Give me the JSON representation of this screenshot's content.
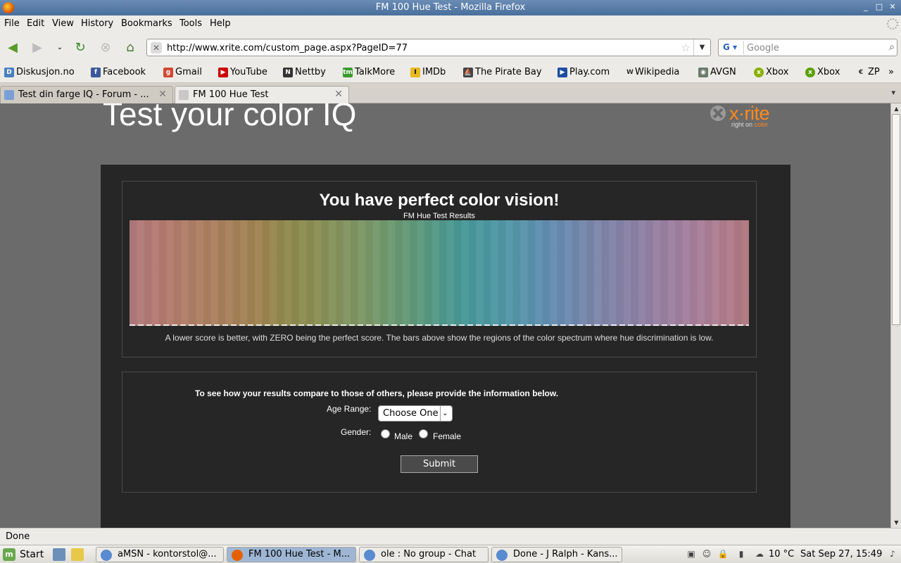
{
  "window": {
    "title": "FM 100 Hue Test - Mozilla Firefox"
  },
  "menu": [
    "File",
    "Edit",
    "View",
    "History",
    "Bookmarks",
    "Tools",
    "Help"
  ],
  "navigation": {
    "url": "http://www.xrite.com/custom_page.aspx?PageID=77",
    "search_placeholder": "Google"
  },
  "bookmarks": [
    {
      "label": "Diskusjon.no",
      "icon": "diskusjon-icon",
      "color": "#4a7fc1"
    },
    {
      "label": "Facebook",
      "icon": "facebook-icon",
      "color": "#3b5998"
    },
    {
      "label": "Gmail",
      "icon": "google-icon",
      "color": "#d14836"
    },
    {
      "label": "YouTube",
      "icon": "youtube-icon",
      "color": "#cc0000"
    },
    {
      "label": "Nettby",
      "icon": "nettby-icon",
      "color": "#333333"
    },
    {
      "label": "TalkMore",
      "icon": "talkmore-icon",
      "color": "#3a9c2e"
    },
    {
      "label": "IMDb",
      "icon": "imdb-icon",
      "color": "#e6b91e"
    },
    {
      "label": "The Pirate Bay",
      "icon": "pirate-ship-icon",
      "color": "#444444"
    },
    {
      "label": "Play.com",
      "icon": "play-icon",
      "color": "#1e4ea0"
    },
    {
      "label": "Wikipedia",
      "icon": "wikipedia-icon",
      "color": "#555555"
    },
    {
      "label": "AVGN",
      "icon": "avgn-icon",
      "color": "#6b7b6b"
    },
    {
      "label": "Xbox",
      "icon": "xbox-icon",
      "color": "#8ab000"
    },
    {
      "label": "Xbox",
      "icon": "xbox-icon",
      "color": "#5aa000"
    },
    {
      "label": "ZP",
      "icon": "zp-icon",
      "color": "#555555"
    }
  ],
  "tabs": [
    {
      "label": "Test din farge IQ - Forum - ...",
      "active": false
    },
    {
      "label": "FM 100 Hue Test",
      "active": true
    }
  ],
  "page": {
    "heading": "Test your color IQ",
    "logo_name": "x·rite",
    "logo_tagline_a": "right on ",
    "logo_tagline_b": "color",
    "result_title": "You have perfect color vision!",
    "chart_title": "FM Hue Test Results",
    "note": "A lower score is better, with ZERO being the perfect score. The bars above show the regions of the color spectrum where hue discrimination is low.",
    "form_intro": "To see how your results compare to those of others, please provide the information below.",
    "age_label": "Age Range:",
    "age_value": "Choose One",
    "gender_label": "Gender:",
    "gender_options": [
      "Male",
      "Female"
    ],
    "submit_label": "Submit"
  },
  "status": "Done",
  "taskbar": {
    "start_label": "Start",
    "tasks": [
      {
        "label": "aMSN - kontorstol@...",
        "active": false
      },
      {
        "label": "FM 100 Hue Test - M...",
        "active": true
      },
      {
        "label": "ole : No group - Chat",
        "active": false
      },
      {
        "label": "Done - J Ralph - Kans...",
        "active": false
      }
    ],
    "weather": "10 °C",
    "clock": "Sat Sep 27, 15:49"
  },
  "chart_data": {
    "type": "bar",
    "title": "FM Hue Test Results",
    "score_values_all_zero": true,
    "spectrum_colors": [
      "#b07a7e",
      "#b47a72",
      "#b27d6a",
      "#ad8061",
      "#a8825a",
      "#a08451",
      "#928a4e",
      "#8c8f52",
      "#87935c",
      "#7e9766",
      "#6f9a70",
      "#61997a",
      "#52998a",
      "#479999",
      "#4e98a3",
      "#5696ab",
      "#5f8fb0",
      "#6d8ab0",
      "#7b87aa",
      "#8683a7",
      "#9182a5",
      "#9e80a2",
      "#a97f9b",
      "#b07d8f",
      "#b0777f"
    ]
  }
}
